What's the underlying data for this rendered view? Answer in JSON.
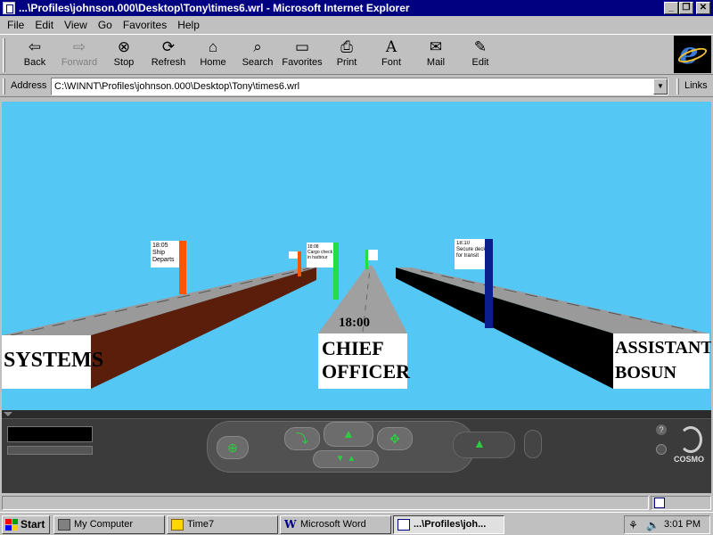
{
  "window": {
    "title": "...\\Profiles\\johnson.000\\Desktop\\Tony\\times6.wrl - Microsoft Internet Explorer",
    "minimize": "_",
    "restore": "❐",
    "close": "✕"
  },
  "menu": [
    "File",
    "Edit",
    "View",
    "Go",
    "Favorites",
    "Help"
  ],
  "toolbar": {
    "buttons": [
      {
        "label": "Back",
        "icon": "back-arrow-icon"
      },
      {
        "label": "Forward",
        "icon": "forward-arrow-icon"
      },
      {
        "label": "Stop",
        "icon": "stop-icon"
      },
      {
        "label": "Refresh",
        "icon": "refresh-icon"
      },
      {
        "label": "Home",
        "icon": "home-icon"
      },
      {
        "label": "Search",
        "icon": "search-icon"
      },
      {
        "label": "Favorites",
        "icon": "favorites-icon"
      },
      {
        "label": "Print",
        "icon": "printer-icon"
      },
      {
        "label": "Font",
        "icon": "font-icon"
      },
      {
        "label": "Mail",
        "icon": "mail-icon"
      },
      {
        "label": "Edit",
        "icon": "edit-icon"
      }
    ]
  },
  "address": {
    "label": "Address",
    "url": "C:\\WINNT\\Profiles\\johnson.000\\Desktop\\Tony\\times6.wrl",
    "links": "Links"
  },
  "scene": {
    "background": "#55c7f5",
    "beams": [
      {
        "name": "SYSTEMS",
        "color": "#5a1e0a"
      },
      {
        "name_line1": "CHIEF",
        "name_line2": "OFFICER",
        "color": "#9a9a9a"
      },
      {
        "name_line1": "ASSISTANT",
        "name_line2": "BOSUN",
        "color": "#000000"
      }
    ],
    "center_time": "18:00",
    "flags": [
      {
        "line1": "18:05",
        "line2": "Ship",
        "line3": "Departs",
        "pole_color": "#ff5500"
      },
      {
        "line1": "18:08",
        "line2": "Cargo checks",
        "line3": "in harbour",
        "pole_color": "#22dd44"
      },
      {
        "line1": "18:10",
        "line2": "Secure decks",
        "line3": "for transit",
        "pole_color": "#0a1e8c"
      }
    ]
  },
  "cosmo": {
    "brand": "COSMO",
    "help": "?"
  },
  "taskbar": {
    "start": "Start",
    "tasks": [
      "My Computer",
      "Time7",
      "Microsoft Word",
      "...\\Profiles\\joh..."
    ],
    "clock": "3:01 PM"
  }
}
